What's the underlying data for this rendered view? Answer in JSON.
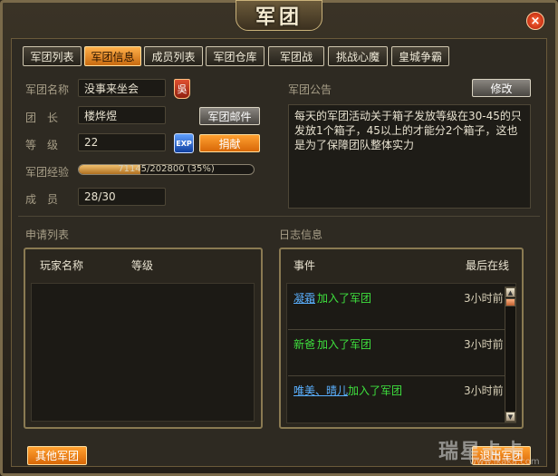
{
  "window": {
    "title": "军团",
    "close_label": "×"
  },
  "tabs": [
    {
      "label": "军团列表",
      "active": false
    },
    {
      "label": "军团信息",
      "active": true
    },
    {
      "label": "成员列表",
      "active": false
    },
    {
      "label": "军团仓库",
      "active": false
    },
    {
      "label": "军团战",
      "active": false
    },
    {
      "label": "挑战心魔",
      "active": false
    },
    {
      "label": "皇城争霸",
      "active": false
    }
  ],
  "info": {
    "name_label": "军团名称",
    "name_value": "没事来坐会",
    "badge_char": "吳",
    "leader_label": "团　长",
    "leader_value": "楼烨煜",
    "mail_button": "军团邮件",
    "level_label": "等　级",
    "level_value": "22",
    "exp_icon_label": "EXP",
    "donate_button": "捐献",
    "exp_label": "军团经验",
    "exp_text": "71145/202800 (35%)",
    "exp_fraction": 0.35,
    "members_label": "成　员",
    "members_value": "28/30"
  },
  "notice": {
    "label": "军团公告",
    "edit_button": "修改",
    "text": "每天的军团活动关于箱子发放等级在30-45的只发放1个箱子，45以上的才能分2个箱子，这也是为了保障团队整体实力"
  },
  "applications": {
    "label": "申请列表",
    "col_name": "玩家名称",
    "col_level": "等级"
  },
  "log": {
    "label": "日志信息",
    "col_event": "事件",
    "col_time": "最后在线",
    "entries": [
      {
        "name": "凝霜",
        "action": "加入了军团",
        "time": "3小时前"
      },
      {
        "name": "新爸",
        "action": "加入了军团",
        "time": "3小时前"
      },
      {
        "name": "唯美、晴儿",
        "action": "加入了军团",
        "time": "3小时前"
      }
    ]
  },
  "footer": {
    "other_button": "其他军团",
    "quit_button": "退出军团"
  },
  "watermark": {
    "main": "瑞星卡卡",
    "sub": "www.ikaka.com"
  },
  "colors": {
    "accent_orange": "#e07a10",
    "link_blue": "#5ab0ff",
    "join_green": "#3ee03e"
  }
}
